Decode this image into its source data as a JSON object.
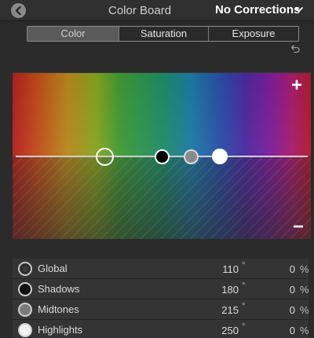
{
  "header": {
    "title": "Color Board",
    "corrections_label": "No Corrections"
  },
  "tabs": [
    {
      "label": "Color",
      "active": true
    },
    {
      "label": "Saturation",
      "active": false
    },
    {
      "label": "Exposure",
      "active": false
    }
  ],
  "board": {
    "plus_label": "+",
    "minus_label": "−"
  },
  "rows": [
    {
      "label": "Global",
      "hue": "110",
      "deg": "°",
      "sat": "0",
      "pct": "%"
    },
    {
      "label": "Shadows",
      "hue": "180",
      "deg": "°",
      "sat": "0",
      "pct": "%"
    },
    {
      "label": "Midtones",
      "hue": "215",
      "deg": "°",
      "sat": "0",
      "pct": "%"
    },
    {
      "label": "Highlights",
      "hue": "250",
      "deg": "°",
      "sat": "0",
      "pct": "%"
    }
  ],
  "icons": {
    "back": "back-arrow-icon",
    "dropdown": "chevron-down-icon",
    "reset": "undo-reset-icon"
  }
}
